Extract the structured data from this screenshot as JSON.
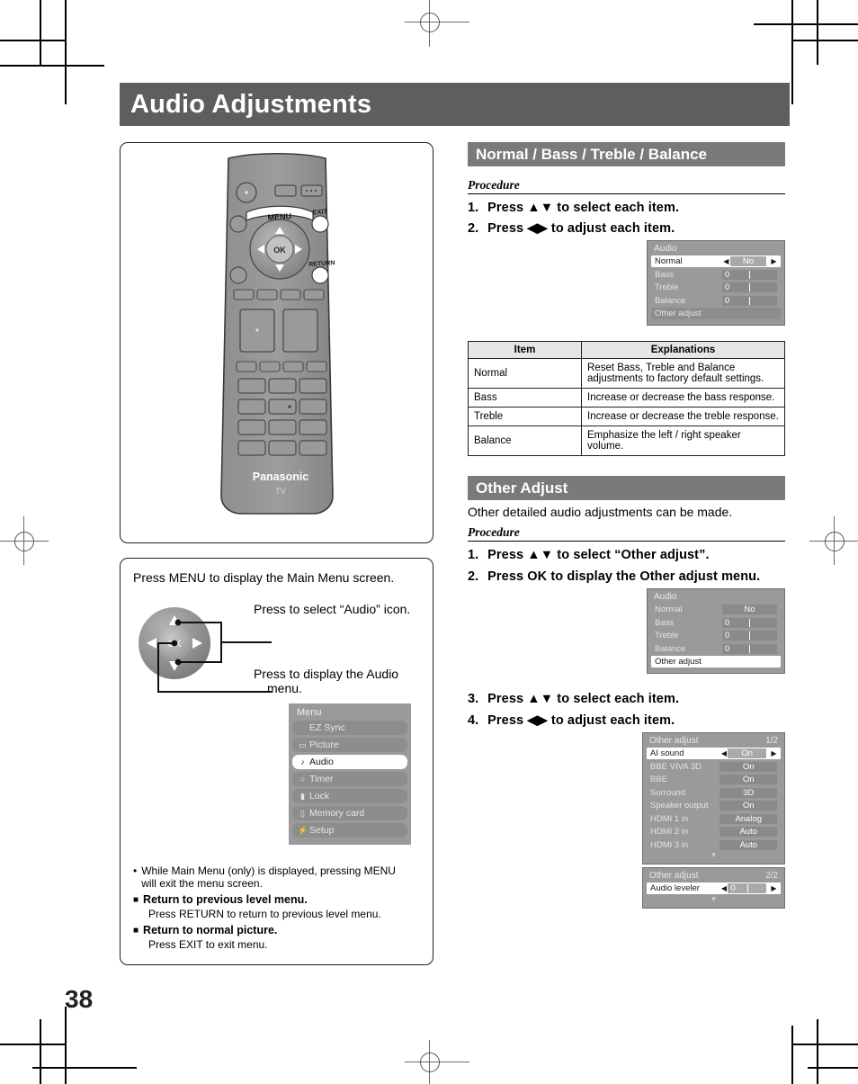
{
  "page": {
    "title": "Audio Adjustments",
    "number": "38"
  },
  "remote": {
    "menu_button_label": "MENU",
    "exit_button_label": "EXIT",
    "return_button_label": "RETURN",
    "ok_button_label": "OK",
    "brand": "Panasonic",
    "brand_sub": "TV"
  },
  "howto": {
    "intro": "Press MENU to display the Main Menu screen.",
    "callout_up": "Press to select “Audio” icon.",
    "callout_ok_line1": "Press to display the Audio",
    "callout_ok_line2": "menu.",
    "bullet_line1": "While Main Menu (only) is displayed, pressing MENU",
    "bullet_line2": "will exit the menu screen.",
    "head1": "Return to previous level menu.",
    "sub1": "Press RETURN to return to previous level menu.",
    "head2": "Return to normal picture.",
    "sub2": "Press EXIT to exit menu.",
    "main_menu": {
      "title": "Menu",
      "items": [
        {
          "label": "EZ Sync",
          "icon": "",
          "selected": false
        },
        {
          "label": "Picture",
          "icon": "picture-icon",
          "glyph": "▭",
          "selected": false
        },
        {
          "label": "Audio",
          "icon": "audio-note-icon",
          "glyph": "♪",
          "selected": true
        },
        {
          "label": "Timer",
          "icon": "clock-icon",
          "glyph": "○",
          "selected": false
        },
        {
          "label": "Lock",
          "icon": "lock-icon",
          "glyph": "▮",
          "selected": false
        },
        {
          "label": "Memory card",
          "icon": "card-icon",
          "glyph": "▯",
          "selected": false
        },
        {
          "label": "Setup",
          "icon": "setup-icon",
          "glyph": "⚡",
          "selected": false
        }
      ]
    }
  },
  "section1": {
    "heading": "Normal / Bass / Treble / Balance",
    "procedure_label": "Procedure",
    "steps": [
      {
        "num": "1.",
        "text": "Press ▲▼ to select each item."
      },
      {
        "num": "2.",
        "text": "Press ◀▶ to adjust each item."
      }
    ],
    "osd": {
      "title": "Audio",
      "page": "",
      "rows": [
        {
          "label": "Normal",
          "value": "No",
          "selected": true,
          "type": "choice"
        },
        {
          "label": "Bass",
          "value": "0",
          "selected": false,
          "type": "slider"
        },
        {
          "label": "Treble",
          "value": "0",
          "selected": false,
          "type": "slider"
        },
        {
          "label": "Balance",
          "value": "0",
          "selected": false,
          "type": "slider"
        },
        {
          "label": "Other adjust",
          "value": "",
          "selected": false,
          "type": "full"
        }
      ]
    },
    "table": {
      "headers": [
        "Item",
        "Explanations"
      ],
      "rows": [
        [
          "Normal",
          "Reset Bass, Treble and Balance adjustments to factory default settings."
        ],
        [
          "Bass",
          "Increase or decrease the bass response."
        ],
        [
          "Treble",
          "Increase or decrease the treble response."
        ],
        [
          "Balance",
          "Emphasize the left / right speaker volume."
        ]
      ]
    }
  },
  "section2": {
    "heading": "Other Adjust",
    "intro": "Other detailed audio adjustments can be made.",
    "procedure_label": "Procedure",
    "steps": [
      {
        "num": "1.",
        "text": "Press ▲▼ to select “Other adjust”."
      },
      {
        "num": "2.",
        "text": "Press OK to display the Other adjust menu."
      }
    ],
    "steps2": [
      {
        "num": "3.",
        "text": "Press ▲▼ to select each item."
      },
      {
        "num": "4.",
        "text": "Press ◀▶ to adjust each item."
      }
    ],
    "osd_audio": {
      "title": "Audio",
      "rows": [
        {
          "label": "Normal",
          "value": "No",
          "selected": false,
          "type": "choice"
        },
        {
          "label": "Bass",
          "value": "0",
          "selected": false,
          "type": "slider"
        },
        {
          "label": "Treble",
          "value": "0",
          "selected": false,
          "type": "slider"
        },
        {
          "label": "Balance",
          "value": "0",
          "selected": false,
          "type": "slider"
        },
        {
          "label": "Other adjust",
          "value": "",
          "selected": true,
          "type": "full"
        }
      ]
    },
    "osd_other1": {
      "title": "Other adjust",
      "page": "1/2",
      "rows": [
        {
          "label": "AI sound",
          "value": "On",
          "selected": true,
          "type": "choice"
        },
        {
          "label": "BBE VIVA 3D",
          "value": "On",
          "selected": false,
          "type": "choice"
        },
        {
          "label": "BBE",
          "value": "On",
          "selected": false,
          "type": "choice"
        },
        {
          "label": "Surround",
          "value": "3D",
          "selected": false,
          "type": "choice"
        },
        {
          "label": "Speaker output",
          "value": "On",
          "selected": false,
          "type": "choice"
        },
        {
          "label": "HDMI 1 in",
          "value": "Analog",
          "selected": false,
          "type": "choice"
        },
        {
          "label": "HDMI 2 in",
          "value": "Auto",
          "selected": false,
          "type": "choice"
        },
        {
          "label": "HDMI 3 in",
          "value": "Auto",
          "selected": false,
          "type": "choice"
        }
      ],
      "scroll_glyph": "▼"
    },
    "osd_other2": {
      "title": "Other adjust",
      "page": "2/2",
      "rows": [
        {
          "label": "Audio leveler",
          "value": "0",
          "selected": true,
          "type": "slider"
        }
      ],
      "scroll_glyph": "▼"
    }
  },
  "colors": {
    "title_bar": "#5e5e5e",
    "section_bar": "#7a7a7a",
    "osd_bg": "#9a9a9a",
    "osd_value": "#8a8a8a",
    "ink": "#231f20"
  }
}
